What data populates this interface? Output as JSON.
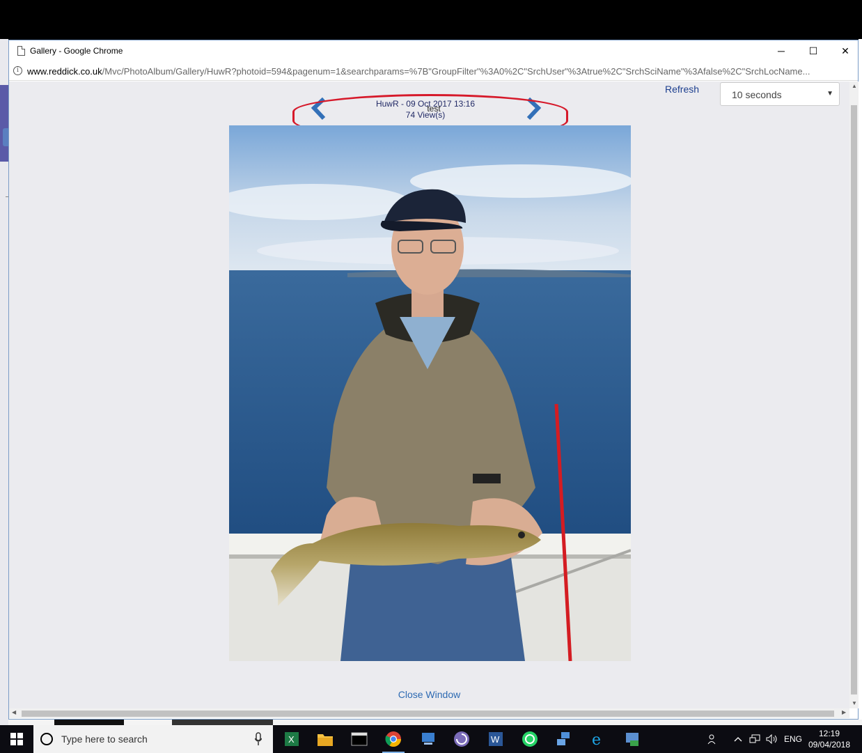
{
  "browser": {
    "window_title": "Gallery - Google Chrome",
    "url_domain": "www.reddick.co.uk",
    "url_path": "/Mvc/PhotoAlbum/Gallery/HuwR?photoid=594&pagenum=1&searchparams=%7B\"GroupFilter\"%3A0%2C\"SrchUser\"%3Atrue%2C\"SrchSciName\"%3Afalse%2C\"SrchLocName...",
    "minimize": "─",
    "maximize": "☐",
    "close": "✕"
  },
  "gallery": {
    "refresh_label": "Refresh",
    "interval_value": "10 seconds",
    "caption_line1": "HuwR - 09 Oct 2017 13:16",
    "caption_comment": "test",
    "caption_line2": "74 View(s)",
    "close_label": "Close Window"
  },
  "taskbar": {
    "search_placeholder": "Type here to search",
    "language": "ENG",
    "time": "12:19",
    "date": "09/04/2018",
    "apps": [
      "excel-icon",
      "file-explorer-icon",
      "terminal-icon",
      "chrome-icon",
      "remote-desktop-icon",
      "app-spiral-icon",
      "word-icon",
      "whatsapp-icon",
      "network-computer-icon",
      "internet-explorer-icon",
      "installer-icon"
    ]
  },
  "colors": {
    "accent_blue": "#2d6ab2",
    "highlight_red": "#d6192a",
    "taskbar_bg": "#0c0c12"
  }
}
